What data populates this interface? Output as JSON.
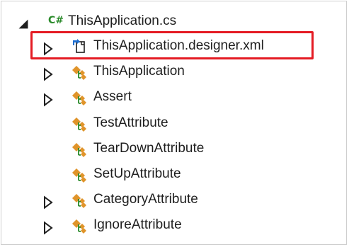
{
  "tree": {
    "root": {
      "badge": "C#",
      "label": "ThisApplication.cs",
      "expanded": true
    },
    "children": [
      {
        "label": "ThisApplication.designer.xml",
        "icon": "xml-file-link-icon",
        "expandable": true,
        "highlighted": true
      },
      {
        "label": "ThisApplication",
        "icon": "class-icon",
        "expandable": true
      },
      {
        "label": "Assert",
        "icon": "class-icon",
        "expandable": true
      },
      {
        "label": "TestAttribute",
        "icon": "class-icon",
        "expandable": false
      },
      {
        "label": "TearDownAttribute",
        "icon": "class-icon",
        "expandable": false
      },
      {
        "label": "SetUpAttribute",
        "icon": "class-icon",
        "expandable": false
      },
      {
        "label": "CategoryAttribute",
        "icon": "class-icon",
        "expandable": true
      },
      {
        "label": "IgnoreAttribute",
        "icon": "class-icon",
        "expandable": true
      }
    ]
  },
  "colors": {
    "highlight": "#e41b23",
    "class_icon": "#e0942a",
    "class_icon_accent": "#2a8a2a",
    "link_arrow": "#1f6fd1",
    "text": "#1e1e1e"
  }
}
